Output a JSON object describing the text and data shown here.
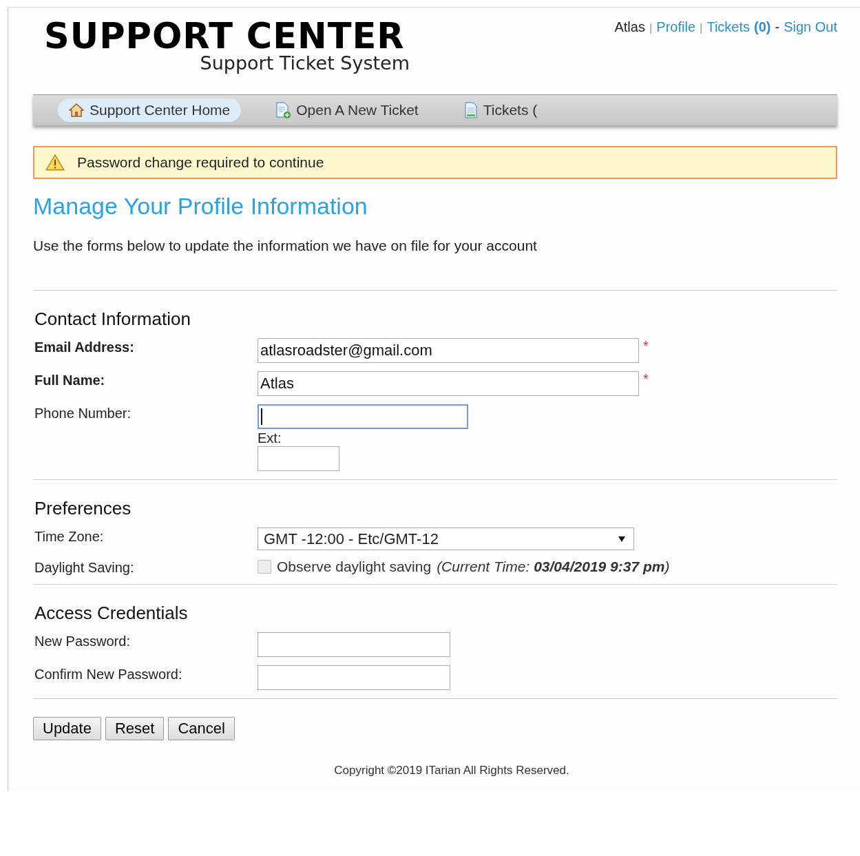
{
  "logo": {
    "title": "SUPPORT CENTER",
    "subtitle": "Support Ticket System"
  },
  "user_nav": [
    {
      "kind": "text",
      "text": "Atlas"
    },
    {
      "kind": "sep",
      "text": "|"
    },
    {
      "kind": "link",
      "text": "Profile"
    },
    {
      "kind": "sep",
      "text": "|"
    },
    {
      "kind": "link",
      "text": "Tickets"
    },
    {
      "kind": "count",
      "text": "(0)"
    },
    {
      "kind": "dash",
      "text": "-"
    },
    {
      "kind": "link",
      "text": "Sign Out"
    }
  ],
  "nav_tabs": [
    {
      "label": "Support Center Home",
      "selected": true
    },
    {
      "label": "Open A New Ticket",
      "selected": false
    },
    {
      "label": "Tickets (",
      "selected": false
    }
  ],
  "alert": "Password change required to continue",
  "heading": "Manage Your Profile Information",
  "intro": "Use the forms below to update the information we have on file for your account",
  "sections": [
    {
      "title": "Contact Information",
      "fields": [
        {
          "kind": "text",
          "label": "Email Address:",
          "required": true,
          "mark": "*",
          "value": "atlasroadster@gmail.com"
        },
        {
          "kind": "text",
          "label": "Full Name:",
          "required": true,
          "mark": "*",
          "value": "Atlas"
        },
        {
          "kind": "phone",
          "label": "Phone Number:",
          "required": false,
          "focused": true,
          "ext_label": "Ext:"
        }
      ]
    },
    {
      "title": "Preferences",
      "fields": [
        {
          "kind": "select",
          "label": "Time Zone:",
          "required": false,
          "value": "GMT -12:00 - Etc/GMT-12"
        },
        {
          "kind": "checkbox",
          "label": "Daylight Saving:",
          "required": false,
          "checked": false,
          "text": "Observe daylight saving",
          "note": "(Current Time: **03/04/2019 9:37 pm**)"
        }
      ]
    },
    {
      "title": "Access Credentials",
      "fields": [
        {
          "kind": "password",
          "label": "New Password:",
          "required": false
        },
        {
          "kind": "password",
          "label": "Confirm New Password:",
          "required": false
        }
      ]
    }
  ],
  "buttons": [
    "Update",
    "Reset",
    "Cancel"
  ],
  "footer": "Copyright ©2019 ITarian All Rights Reserved."
}
